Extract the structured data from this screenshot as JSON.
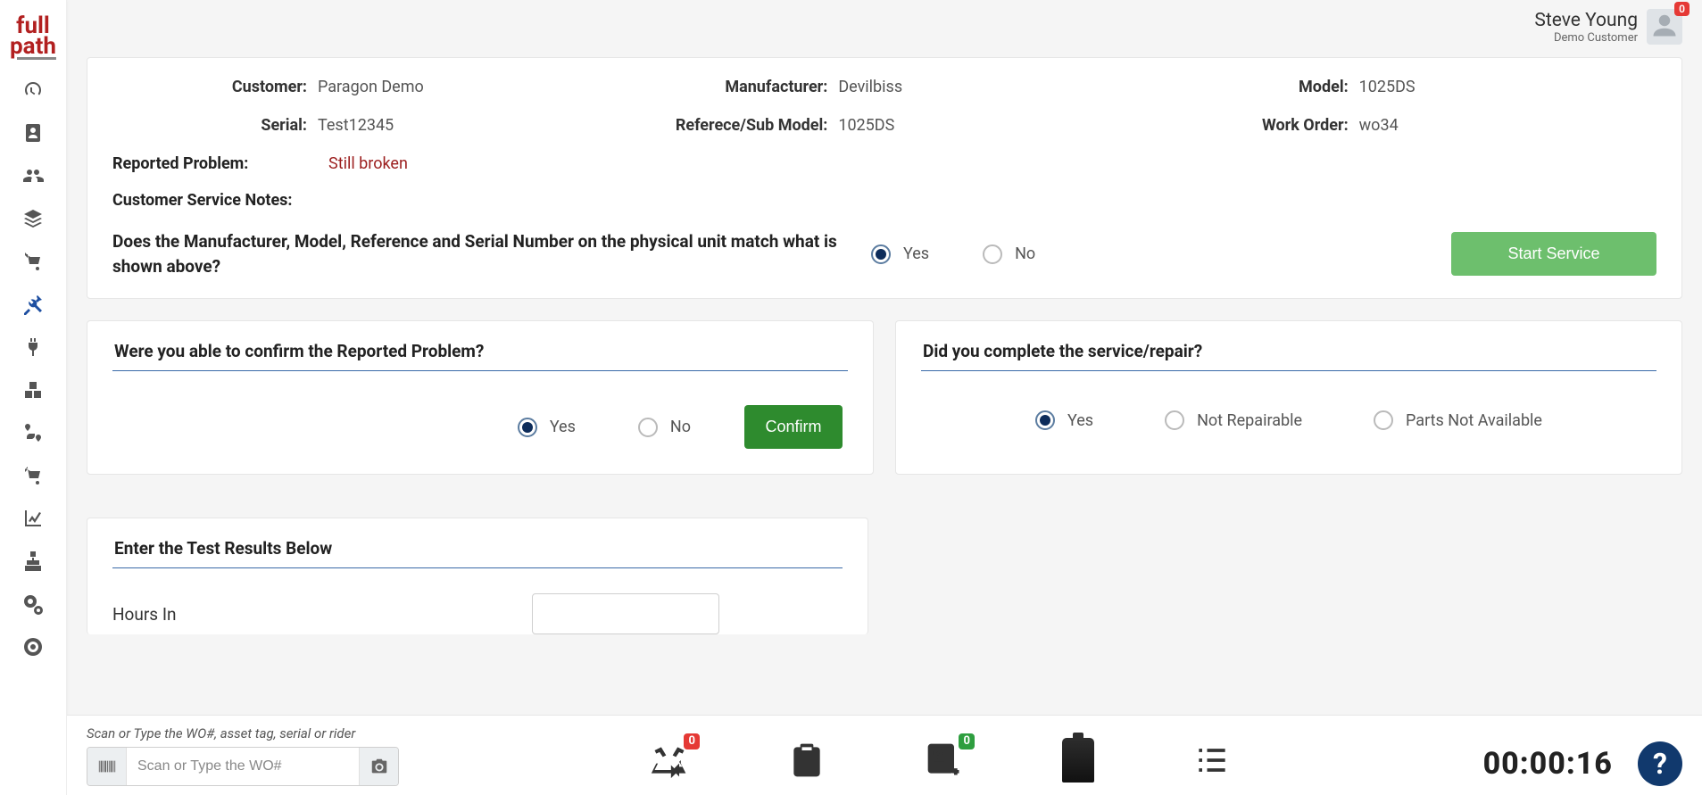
{
  "brand": {
    "line1": "full",
    "line2": "path"
  },
  "user": {
    "name": "Steve Young",
    "role": "Demo Customer",
    "notif_count": "0"
  },
  "header": {
    "customer_label": "Customer:",
    "customer": "Paragon Demo",
    "manufacturer_label": "Manufacturer:",
    "manufacturer": "Devilbiss",
    "model_label": "Model:",
    "model": "1025DS",
    "serial_label": "Serial:",
    "serial": "Test12345",
    "ref_label": "Referece/Sub Model:",
    "ref": "1025DS",
    "wo_label": "Work Order:",
    "wo": "wo34",
    "reported_label": "Reported Problem:",
    "reported_value": "Still broken",
    "notes_label": "Customer Service Notes:",
    "match_question": "Does the Manufacturer, Model, Reference and Serial Number on the physical unit match what is shown above?",
    "yes": "Yes",
    "no": "No",
    "start_service": "Start Service"
  },
  "confirm_panel": {
    "title": "Were you able to confirm the Reported Problem?",
    "yes": "Yes",
    "no": "No",
    "confirm_btn": "Confirm"
  },
  "complete_panel": {
    "title": "Did you complete the service/repair?",
    "yes": "Yes",
    "not_repairable": "Not Repairable",
    "parts_na": "Parts Not Available"
  },
  "test_panel": {
    "title": "Enter the Test Results Below",
    "hours_in_label": "Hours In"
  },
  "dock": {
    "hint": "Scan or Type the WO#, asset tag, serial or rider",
    "placeholder": "Scan or Type the WO#",
    "recycle_badge": "0",
    "device_badge": "0",
    "timer": "00:00:16"
  }
}
